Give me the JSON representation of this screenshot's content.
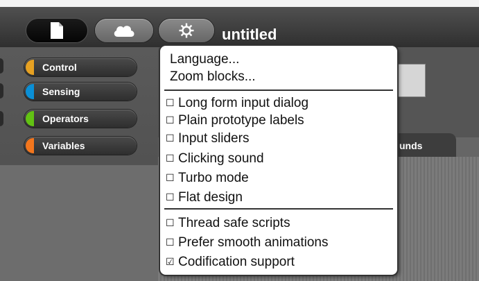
{
  "app": {
    "project_title": "untitled"
  },
  "toolbar": {
    "buttons": [
      {
        "icon": "file-icon"
      },
      {
        "icon": "cloud-icon"
      },
      {
        "icon": "gear-icon"
      }
    ]
  },
  "categories": [
    {
      "label": "Control",
      "color": "#e6a122"
    },
    {
      "label": "Sensing",
      "color": "#0a8fd6"
    },
    {
      "label": "Operators",
      "color": "#62c213"
    },
    {
      "label": "Variables",
      "color": "#f3761d"
    }
  ],
  "tabs": {
    "sounds_label": "unds"
  },
  "settings_menu": {
    "items": [
      {
        "label": "Language...",
        "check": ""
      },
      {
        "label": "Zoom blocks...",
        "check": ""
      },
      {
        "label": "Long form input dialog",
        "check": "☐"
      },
      {
        "label": "Plain prototype labels",
        "check": "☐"
      },
      {
        "label": "Input sliders",
        "check": "☐"
      },
      {
        "label": "Clicking sound",
        "check": "☐"
      },
      {
        "label": "Turbo mode",
        "check": "☐"
      },
      {
        "label": "Flat design",
        "check": "☐"
      },
      {
        "label": "Thread safe scripts",
        "check": "☐"
      },
      {
        "label": "Prefer smooth animations",
        "check": "☐"
      },
      {
        "label": "Codification support",
        "check": "☑"
      }
    ]
  }
}
